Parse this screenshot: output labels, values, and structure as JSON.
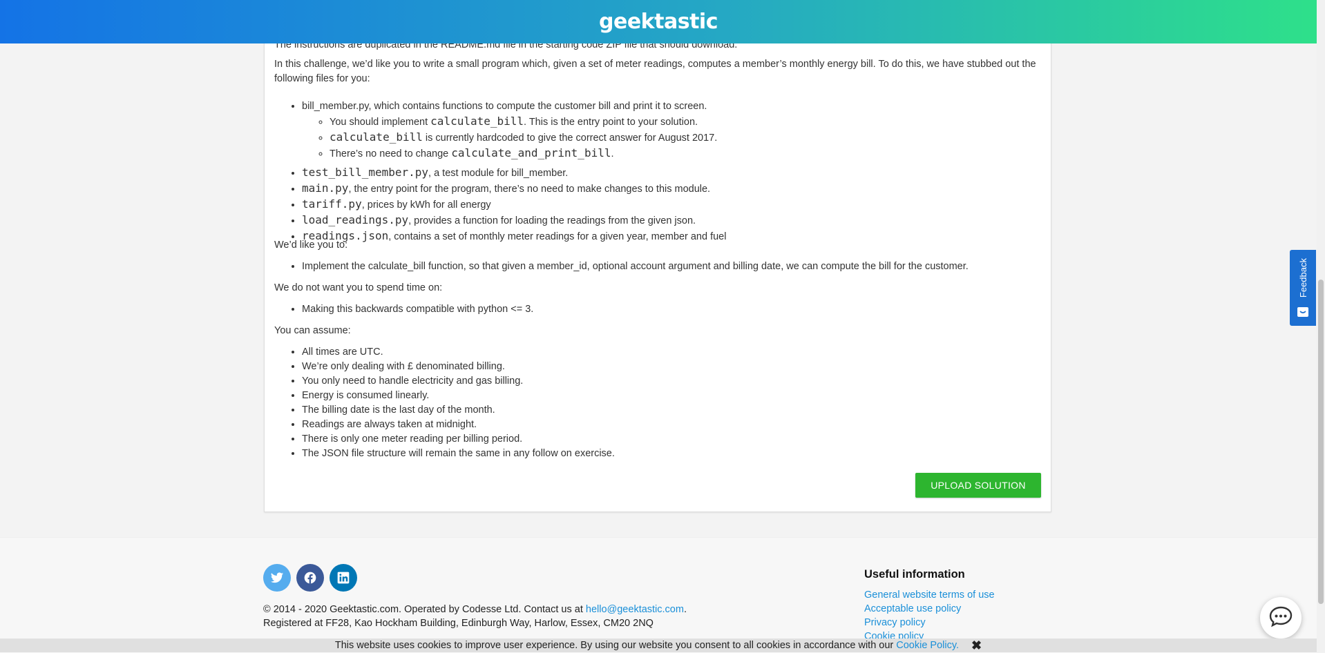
{
  "header": {
    "logo": "geektastic"
  },
  "challenge": {
    "clipped_line": "The instructions are duplicated in the README.md file in the starting code ZIP file that should download.",
    "intro": "In this challenge, we’d like you to write a small program which, given a set of meter readings, computes a member’s monthly energy bill. To do this, we have stubbed out the following files for you:",
    "bill_member": {
      "text": "bill_member.py, which contains functions to compute the customer bill and print it to screen.",
      "sub": [
        {
          "pre": "You should implement ",
          "code": "calculate_bill",
          "post": ". This is the entry point to your solution."
        },
        {
          "pre": "",
          "code": "calculate_bill",
          "post": " is currently hardcoded to give the correct answer for August 2017."
        },
        {
          "pre": "There’s no need to change ",
          "code": "calculate_and_print_bill",
          "post": "."
        }
      ]
    },
    "files": [
      {
        "code": "test_bill_member.py",
        "post": ", a test module for bill_member."
      },
      {
        "code": "main.py",
        "post": ", the entry point for the program, there’s no need to make changes to this module."
      },
      {
        "code": "tariff.py",
        "post": ", prices by kWh for all energy"
      },
      {
        "code": "load_readings.py",
        "post": ", provides a function for loading the readings from the given json."
      },
      {
        "code": "readings.json",
        "post": ", contains a set of monthly meter readings for a given year, member and fuel"
      }
    ],
    "like_heading": "We’d like you to:",
    "like_items": [
      "Implement the calculate_bill function, so that given a member_id, optional account argument and billing date, we can compute the bill for the customer."
    ],
    "not_heading": "We do not want you to spend time on:",
    "not_items": [
      "Making this backwards compatible with python <= 3."
    ],
    "assume_heading": "You can assume:",
    "assume_items": [
      "All times are UTC.",
      "We’re only dealing with £ denominated billing.",
      "You only need to handle electricity and gas billing.",
      "Energy is consumed linearly.",
      "The billing date is the last day of the month.",
      "Readings are always taken at midnight.",
      "There is only one meter reading per billing period.",
      "The JSON file structure will remain the same in any follow on exercise."
    ],
    "upload_label": "UPLOAD SOLUTION"
  },
  "footer": {
    "copyright_pre": "© 2014 - 2020 Geektastic.com. Operated by Codesse Ltd. Contact us at ",
    "email": "hello@geektastic.com",
    "copyright_post": ".",
    "address": "Registered at FF28, Kao Hockham Building, Edinburgh Way, Harlow, Essex, CM20 2NQ",
    "useful_heading": "Useful information",
    "links": [
      "General website terms of use",
      "Acceptable use policy",
      "Privacy policy",
      "Cookie policy"
    ]
  },
  "feedback_label": "Feedback",
  "cookie": {
    "text": "This website uses cookies to improve user experience. By using our website you consent to all cookies in accordance with our",
    "link": "Cookie Policy."
  },
  "icons": [
    "twitter-icon",
    "facebook-icon",
    "linkedin-icon",
    "chat-icon",
    "close-icon",
    "feedback-icon"
  ]
}
